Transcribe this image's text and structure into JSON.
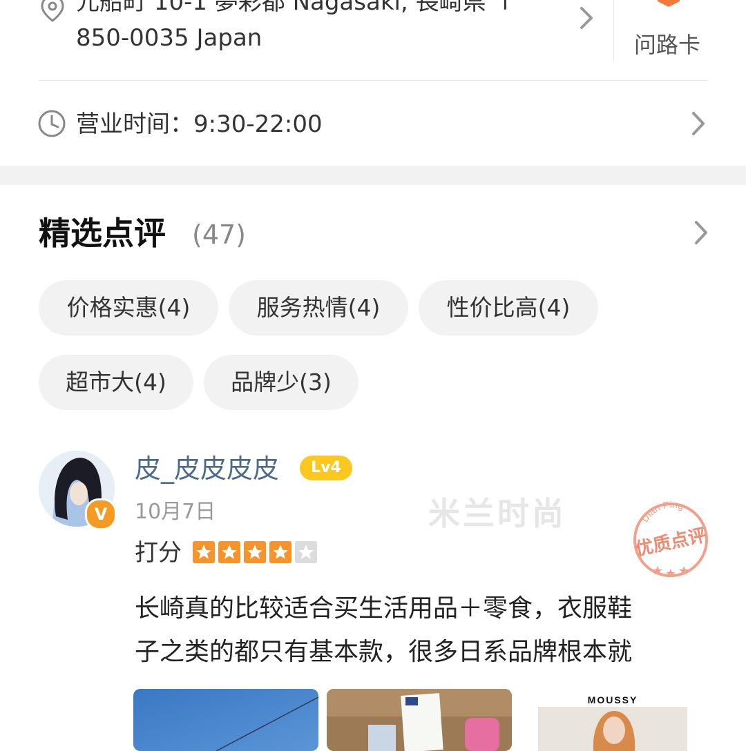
{
  "address": {
    "line1": "元船町 10-1 夢彩都 Nagasaki, 長崎県 〒",
    "line2": "850-0035 Japan",
    "route_card_label": "问路卡"
  },
  "hours": {
    "label": "营业时间：",
    "value": "9:30-22:00"
  },
  "reviews": {
    "title": "精选点评",
    "count": "(47)",
    "tags": [
      {
        "label": "价格实惠(4)"
      },
      {
        "label": "服务热情(4)"
      },
      {
        "label": "性价比高(4)"
      },
      {
        "label": "超市大(4)"
      },
      {
        "label": "品牌少(3)"
      }
    ],
    "items": [
      {
        "username": "皮_皮皮皮皮",
        "level": "Lv4",
        "verified_badge": "V",
        "date": "10月7日",
        "score_label": "打分",
        "rating": 4,
        "max_rating": 5,
        "quality_seal": {
          "top": "Dian Ping",
          "middle": "优质点评"
        },
        "text_lines": [
          "长崎真的比较适合买生活用品＋零食，衣服鞋",
          "子之类的都只有基本款，很多日系品牌根本就"
        ],
        "photo_captions": [
          "MOUSSY"
        ]
      }
    ]
  },
  "colors": {
    "accent_orange": "#f59a23",
    "star_on": "#f7932b",
    "star_off": "#dcdcdc",
    "username": "#4a6a8e",
    "level_badge": "#fcc820"
  },
  "icons": {
    "location": "location-pin-icon",
    "clock": "clock-icon",
    "chevron": "chevron-right-icon",
    "route": "route-card-icon"
  }
}
